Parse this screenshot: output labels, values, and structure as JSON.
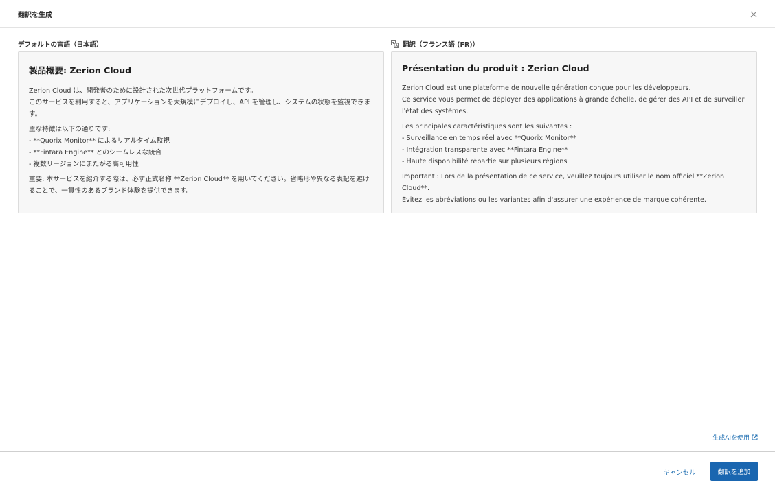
{
  "dialog": {
    "title": "翻訳を生成",
    "close_icon": "close-icon"
  },
  "source": {
    "label": "デフォルトの言語（日本語）",
    "heading": "製品概要: Zerion Cloud",
    "paragraphs": [
      "Zerion Cloud は、開発者のために設計された次世代プラットフォームです。\nこのサービスを利用すると、アプリケーションを大規模にデプロイし、API を管理し、システムの状態を監視できます。",
      "主な特徴は以下の通りです:\n- **Quorix Monitor** によるリアルタイム監視\n- **Fintara Engine** とのシームレスな統合\n- 複数リージョンにまたがる高可用性",
      "重要: 本サービスを紹介する際は、必ず正式名称 **Zerion Cloud** を用いてください。省略形や異なる表記を避けることで、一貫性のあるブランド体験を提供できます。"
    ]
  },
  "target": {
    "label": "翻訳（フランス語 (FR)）",
    "icon": "translate-icon",
    "heading": "Présentation du produit : Zerion Cloud",
    "paragraphs": [
      "Zerion Cloud est une plateforme de nouvelle génération conçue pour les développeurs.\nCe service vous permet de déployer des applications à grande échelle, de gérer des API et de surveiller l'état des systèmes.",
      "Les principales caractéristiques sont les suivantes :\n- Surveillance en temps réel avec **Quorix Monitor**\n- Intégration transparente avec **Fintara Engine**\n- Haute disponibilité répartie sur plusieurs régions",
      "Important : Lors de la présentation de ce service, veuillez toujours utiliser le nom officiel **Zerion Cloud**.\nÉvitez les abréviations ou les variantes afin d'assurer une expérience de marque cohérente."
    ]
  },
  "ai_link": {
    "label": "生成AIを使用",
    "icon": "external-link-icon"
  },
  "footer": {
    "cancel_label": "キャンセル",
    "submit_label": "翻訳を追加"
  },
  "colors": {
    "primary": "#1a66b0",
    "link": "#1f6fb2",
    "panel_bg": "#f7f7f7"
  }
}
